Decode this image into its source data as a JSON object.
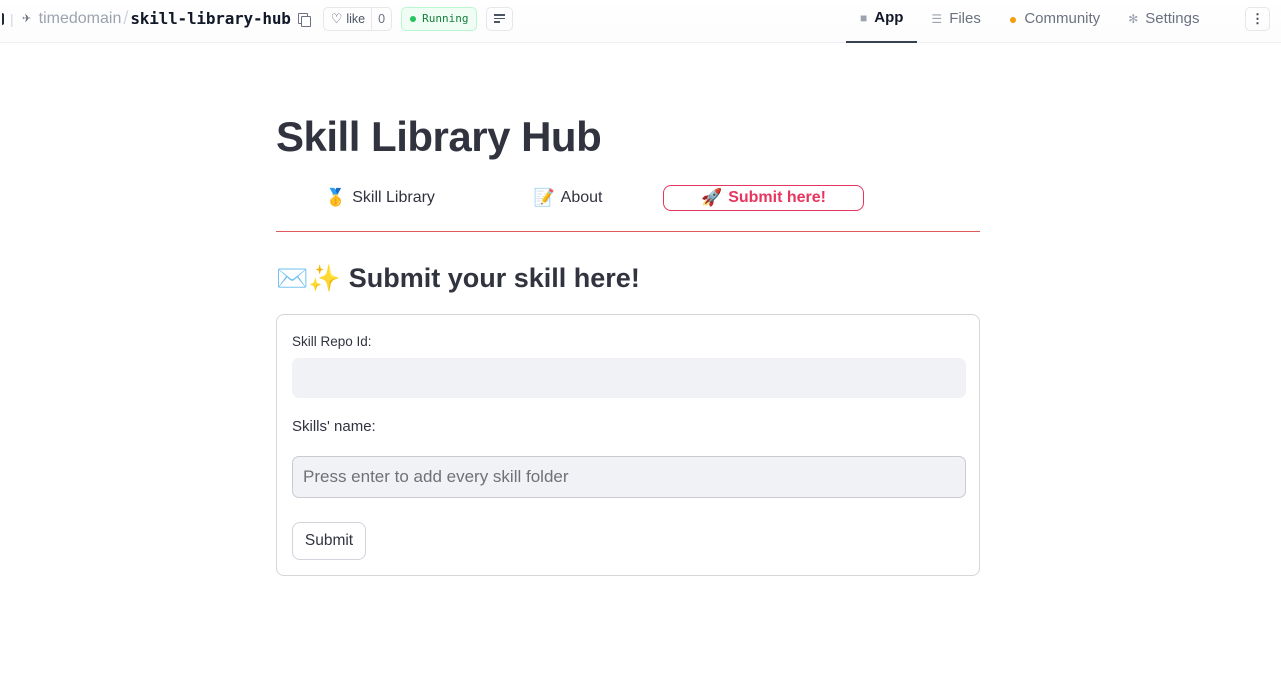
{
  "header": {
    "owner": "timedomain",
    "separator": "/",
    "repo": "skill-library-hub",
    "like_label": "like",
    "like_count": "0",
    "status": "Running",
    "tabs": [
      {
        "label": "App",
        "icon": "app-cube-icon",
        "active": true
      },
      {
        "label": "Files",
        "icon": "files-icon",
        "active": false
      },
      {
        "label": "Community",
        "icon": "community-icon",
        "active": false
      },
      {
        "label": "Settings",
        "icon": "gear-icon",
        "active": false
      }
    ]
  },
  "app": {
    "title": "Skill Library Hub",
    "nav": [
      {
        "emoji": "🥇",
        "label": "Skill Library"
      },
      {
        "emoji": "📝",
        "label": "About"
      },
      {
        "emoji": "🚀",
        "label": "Submit here!"
      }
    ],
    "selected_nav": "Submit here!",
    "accent_color": "#e6365f",
    "section_emoji": "✉️✨",
    "section_title": "Submit your skill here!",
    "form": {
      "repo_label": "Skill Repo Id:",
      "repo_value": "",
      "skills_label": "Skills' name:",
      "skills_placeholder": "Press enter to add every skill folder",
      "submit_label": "Submit"
    }
  }
}
